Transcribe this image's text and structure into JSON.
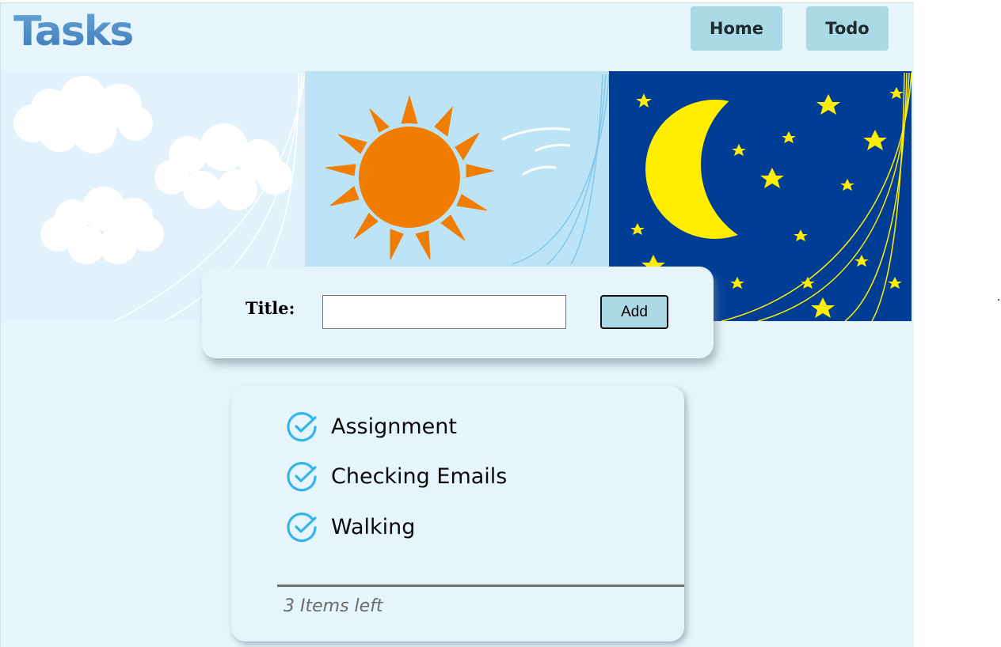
{
  "header": {
    "brand": "Tasks",
    "nav": {
      "home_label": "Home",
      "todo_label": "Todo"
    }
  },
  "banner": {
    "panels": [
      "clouds-panel",
      "sun-panel",
      "moon-night-panel"
    ],
    "colors": {
      "day_sky": "#e2f1fa",
      "sun_sky": "#bde3f7",
      "sun": "#f07d00",
      "night_sky": "#003e96",
      "moon": "#ffee00"
    }
  },
  "form": {
    "title_label": "Title:",
    "title_value": "",
    "title_placeholder": "",
    "add_label": "Add"
  },
  "tasks": {
    "items": [
      {
        "text": "Assignment",
        "icon": "check-circle-icon"
      },
      {
        "text": "Checking Emails",
        "icon": "check-circle-icon"
      },
      {
        "text": "Walking",
        "icon": "check-circle-icon"
      }
    ],
    "footer": "3 Items left"
  },
  "colors": {
    "app_bg": "#e6f4fb",
    "nav_button": "#acd9e6",
    "add_button": "#add8e6",
    "check": "#32b5ec"
  }
}
